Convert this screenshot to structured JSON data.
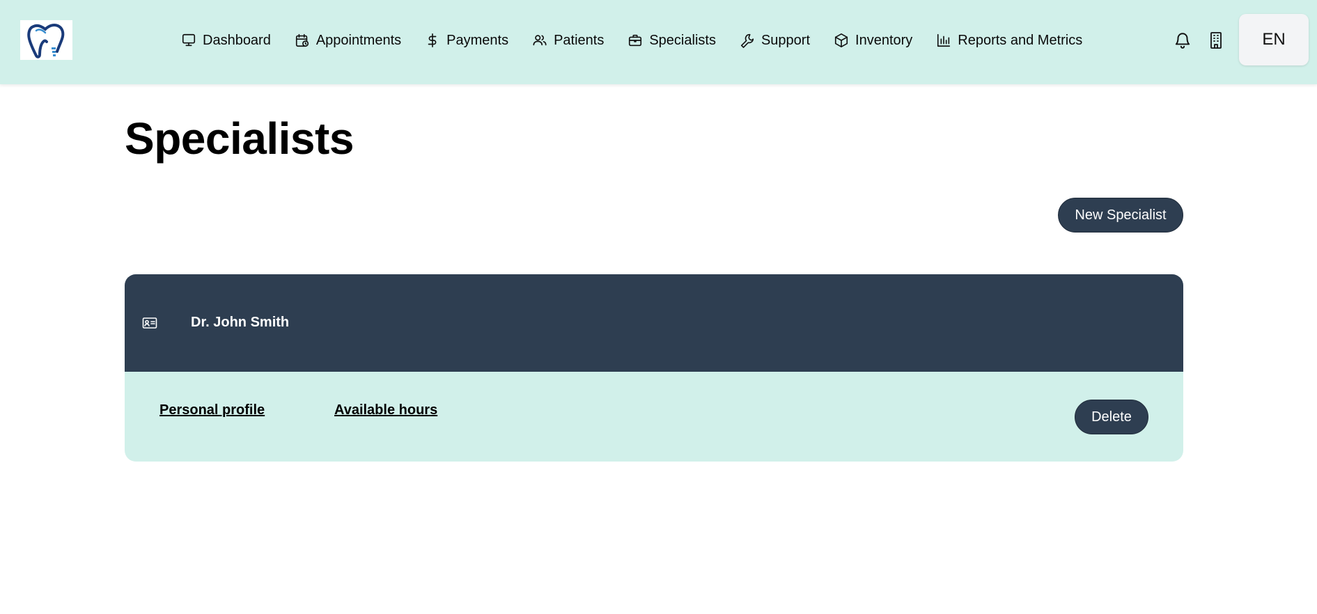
{
  "app": {
    "logo_name": "tooth-logo"
  },
  "nav": {
    "items": [
      {
        "label": "Dashboard",
        "icon": "monitor-icon"
      },
      {
        "label": "Appointments",
        "icon": "calendar-clock-icon"
      },
      {
        "label": "Payments",
        "icon": "dollar-icon"
      },
      {
        "label": "Patients",
        "icon": "users-icon"
      },
      {
        "label": "Specialists",
        "icon": "briefcase-icon"
      },
      {
        "label": "Support",
        "icon": "wrench-icon"
      },
      {
        "label": "Inventory",
        "icon": "box-icon"
      },
      {
        "label": "Reports and Metrics",
        "icon": "bar-chart-icon"
      }
    ],
    "language": "EN"
  },
  "page": {
    "title": "Specialists",
    "new_button": "New Specialist"
  },
  "specialists": [
    {
      "name": "Dr. John Smith",
      "links": {
        "profile": "Personal profile",
        "hours": "Available hours"
      },
      "delete_label": "Delete"
    }
  ],
  "colors": {
    "header_bg": "#d1f0ea",
    "dark_accent": "#2e3e51",
    "lang_bg": "#f3f4f6"
  }
}
